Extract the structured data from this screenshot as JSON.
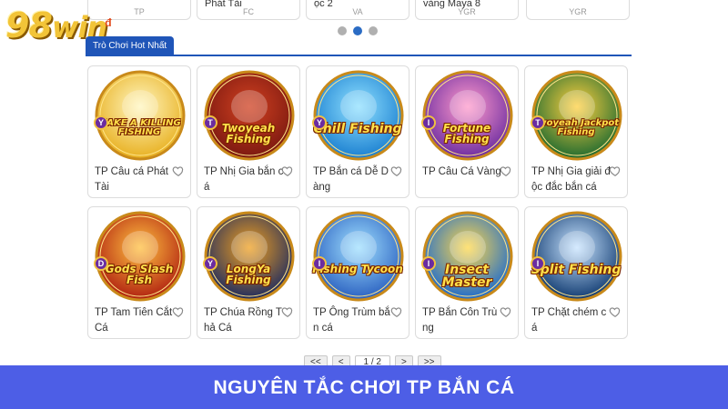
{
  "brand": {
    "logo_number": "98",
    "logo_word": "win",
    "logo_superscript": "đ"
  },
  "top_row": [
    {
      "name": "",
      "provider": "TP"
    },
    {
      "name": "Phát Tài",
      "provider": "FC"
    },
    {
      "name": "ọc 2",
      "provider": "VA"
    },
    {
      "name": "vàng Maya 8",
      "provider": "YGR"
    },
    {
      "name": "",
      "provider": "YGR"
    }
  ],
  "carousel": {
    "dots": 3,
    "active_index": 1
  },
  "section": {
    "title": "Trò Chơi Hot Nhất"
  },
  "games": [
    {
      "title": "TP Câu cá Phát Tài",
      "logo": "MAKE A KILLING FISHING",
      "badge": "Y",
      "icon": "coin-burst-icon",
      "bg": "#e8b020",
      "bg2": "#fff6c0"
    },
    {
      "title": "TP Nhị Gia bắn cá",
      "logo": "Twoyeah Fishing",
      "badge": "T",
      "icon": "general-icon",
      "bg": "#7a1810",
      "bg2": "#d04020"
    },
    {
      "title": "TP Bắn cá Dễ Dàng",
      "logo": "Chill Fishing",
      "badge": "Y",
      "icon": "shark-icon",
      "bg": "#1a7fd0",
      "bg2": "#8fe0ff"
    },
    {
      "title": "TP Câu Cá Vàng",
      "logo": "Fortune Fishing",
      "badge": "I",
      "icon": "god-of-wealth-icon",
      "bg": "#6b2ca0",
      "bg2": "#ff9acb"
    },
    {
      "title": "TP Nhị Gia giải độc đắc bắn cá",
      "logo": "Twoyeah Jackpot Fishing",
      "badge": "T",
      "icon": "warrior-icon",
      "bg": "#1e6a30",
      "bg2": "#ffd040"
    },
    {
      "title": "TP Tam Tiên Cắt Cá",
      "logo": "Gods Slash Fish",
      "badge": "D",
      "icon": "lucky-god-icon",
      "bg": "#b02010",
      "bg2": "#ffc040"
    },
    {
      "title": "TP Chúa Rồng Thả Cá",
      "logo": "LongYa Fishing",
      "badge": "Y",
      "icon": "dragon-icon",
      "bg": "#1c2a60",
      "bg2": "#f0a020"
    },
    {
      "title": "TP Ông Trùm bắn cá",
      "logo": "Fishing Tycoon",
      "badge": "I",
      "icon": "tycoon-shark-icon",
      "bg": "#2a60c0",
      "bg2": "#a0e0ff"
    },
    {
      "title": "TP Bắn Côn Trùng",
      "logo": "Insect Master",
      "badge": "I",
      "icon": "insect-icon",
      "bg": "#1a6ad0",
      "bg2": "#ffd84a"
    },
    {
      "title": "TP Chặt chém cá",
      "logo": "Split Fishing",
      "badge": "I",
      "icon": "sword-fish-icon",
      "bg": "#103a70",
      "bg2": "#c8e4ff"
    }
  ],
  "pagination": {
    "first": "<<",
    "prev": "<",
    "page": "1 / 2",
    "next": ">",
    "last": ">>"
  },
  "banner": {
    "text": "NGUYÊN TẮC CHƠI TP BẮN CÁ",
    "color": "#4d5ee6"
  }
}
